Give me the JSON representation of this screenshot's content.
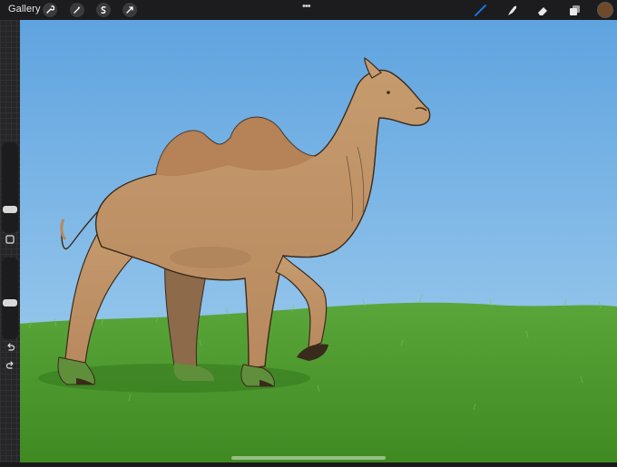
{
  "app": {
    "gallery_label": "Gallery",
    "more_label": "•••"
  },
  "toolbar_left": [
    "wrench-icon",
    "magic-wand-icon",
    "selection-icon",
    "transform-arrow-icon"
  ],
  "toolbar_right": [
    "brush-icon",
    "smudge-icon",
    "eraser-icon",
    "layers-icon"
  ],
  "colors": {
    "accent": "#1a7cf5",
    "current_color": "#6e4a2a",
    "sky": "#7fb6e6",
    "grass": "#4e9a2c"
  },
  "sidebar": {
    "brush_size": 0.5,
    "opacity": 0.5,
    "modify_icon": "square-icon",
    "undo_icon": "undo-icon",
    "redo_icon": "redo-icon"
  }
}
